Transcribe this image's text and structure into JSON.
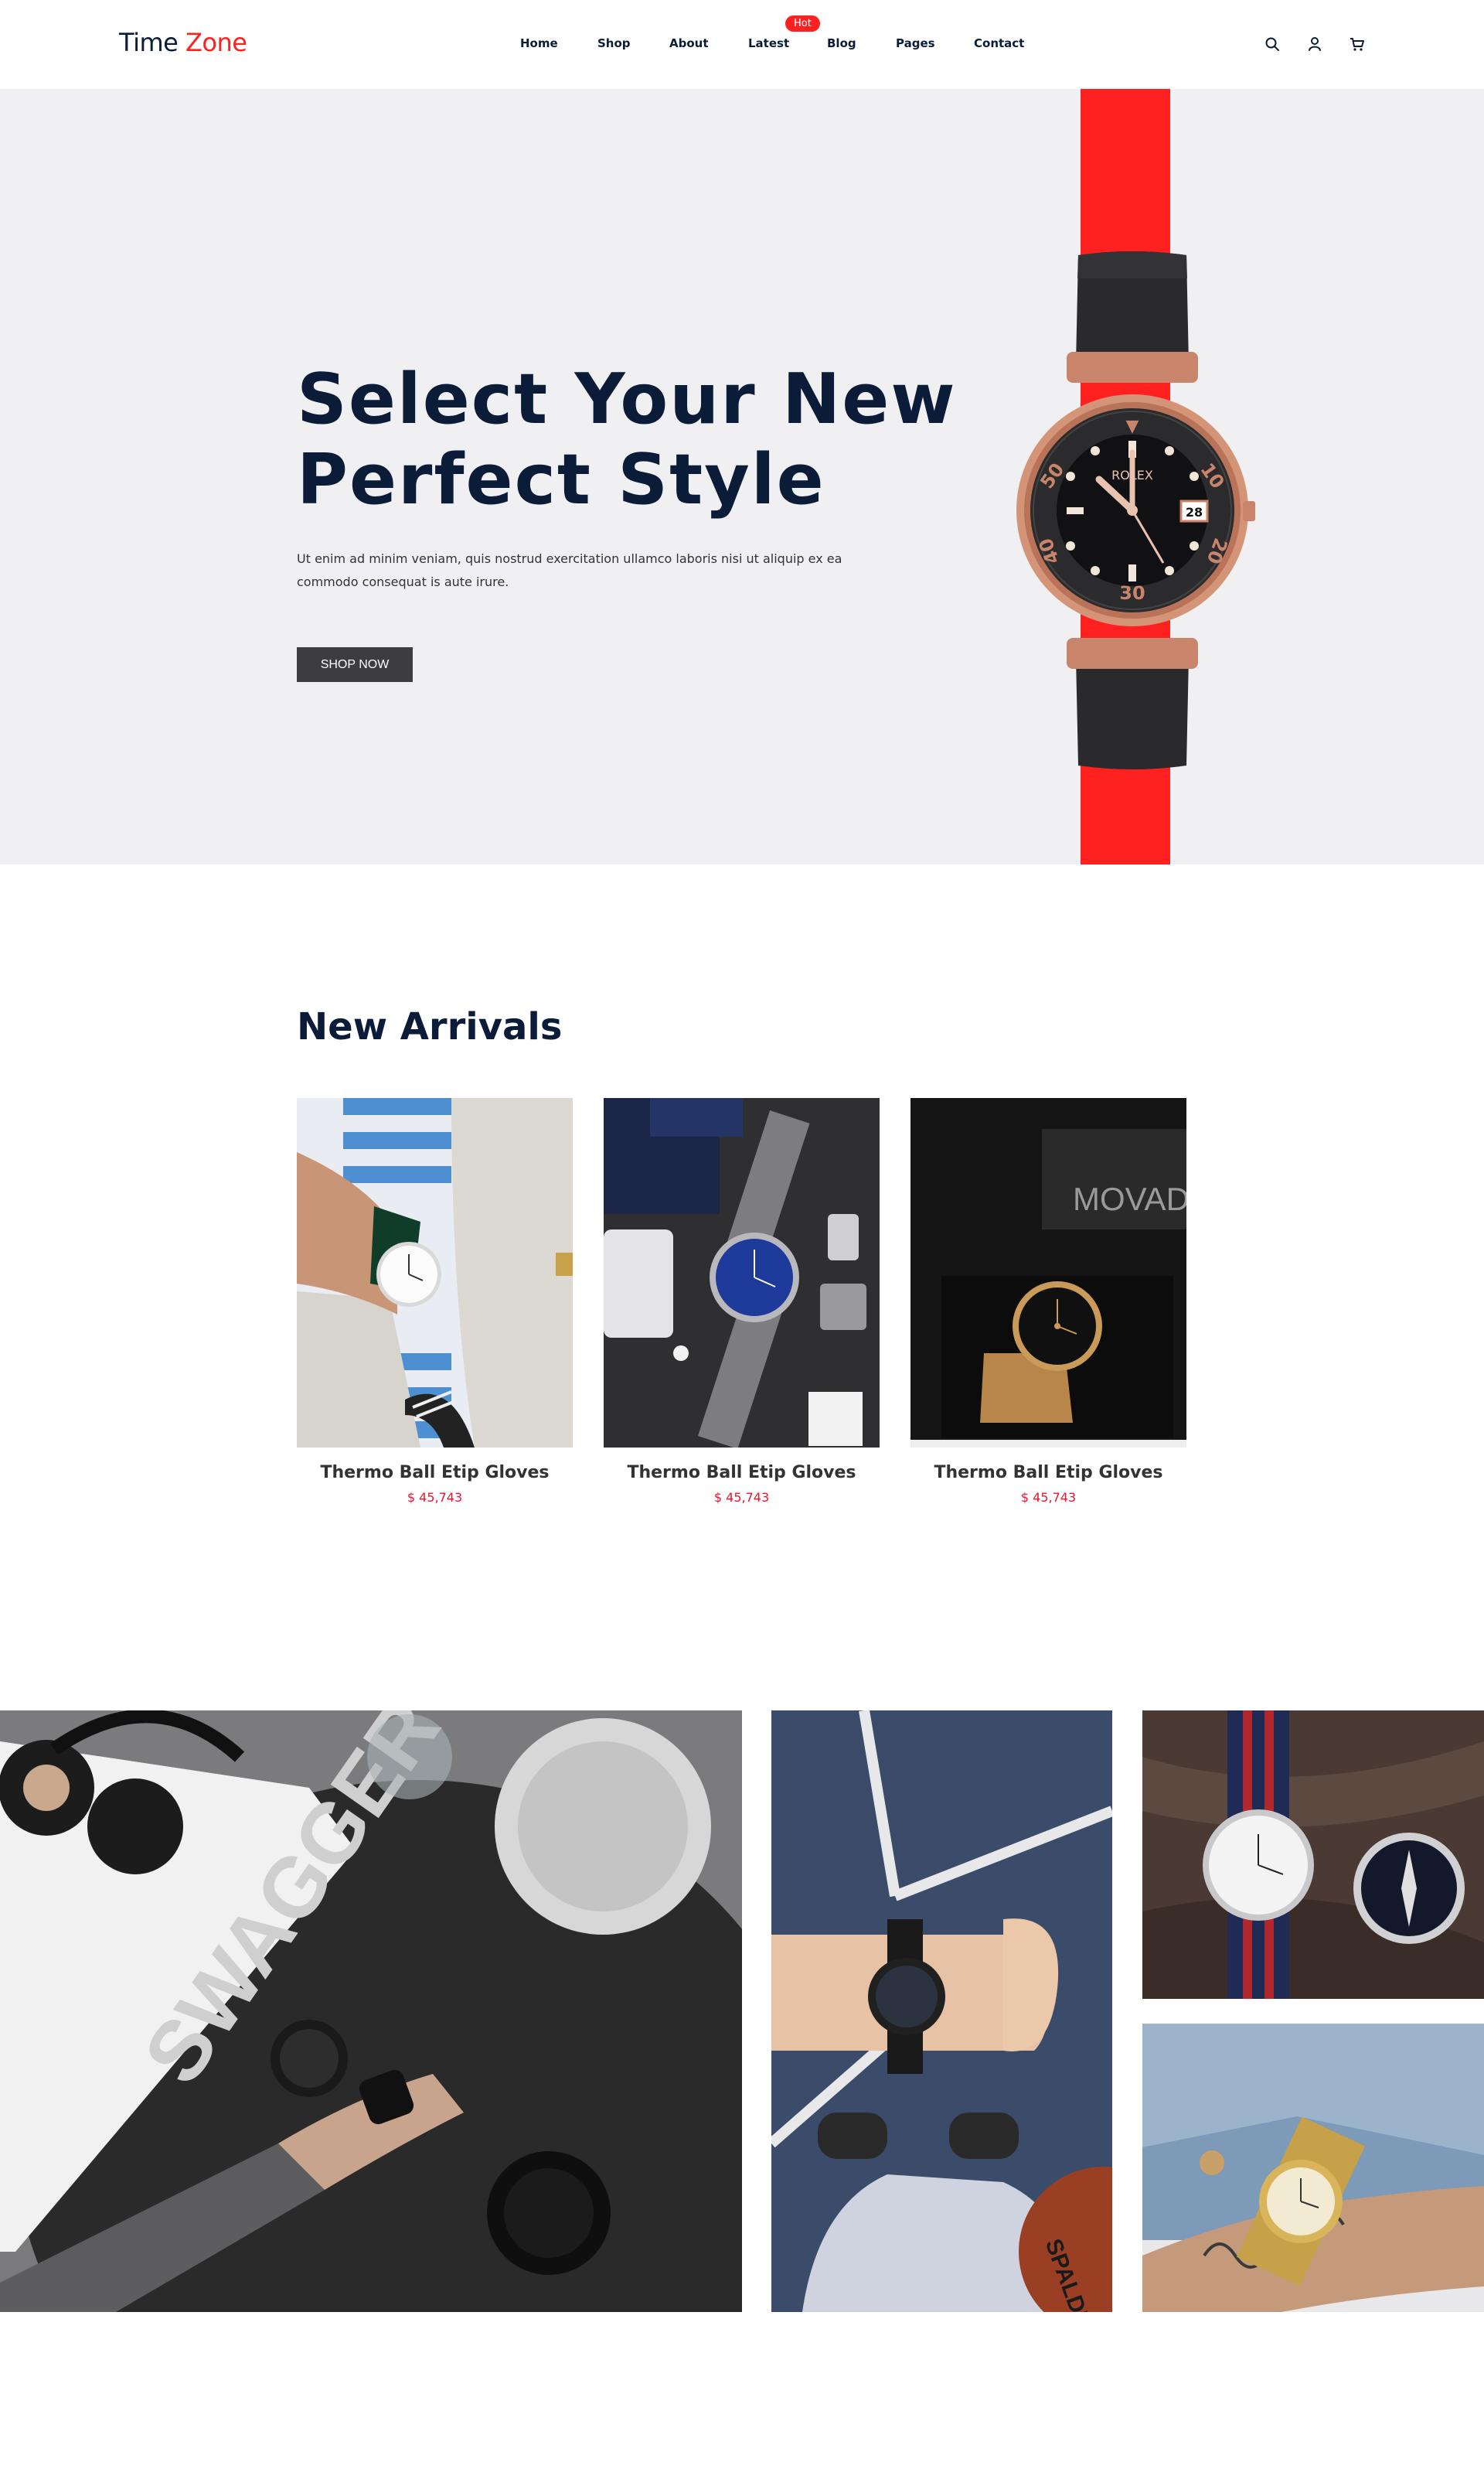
{
  "header": {
    "logo_primary": "Time",
    "logo_accent": "Zone",
    "nav": [
      "Home",
      "Shop",
      "About",
      "Latest",
      "Blog",
      "Pages",
      "Contact"
    ],
    "hot_badge": "Hot",
    "icons": [
      "search-icon",
      "user-icon",
      "cart-icon"
    ]
  },
  "hero": {
    "title": "Select Your New\nPerfect Style",
    "description": "Ut enim ad minim veniam, quis nostrud exercitation ullamco laboris nisi ut aliquip ex ea commodo consequat is aute irure.",
    "button_label": "SHOP NOW",
    "watch_brand": "ROLEX",
    "accent_color": "#ff2020"
  },
  "arrivals": {
    "title": "New Arrivals",
    "products": [
      {
        "name": "Thermo Ball Etip Gloves",
        "price": "$ 45,743"
      },
      {
        "name": "Thermo Ball Etip Gloves",
        "price": "$ 45,743"
      },
      {
        "name": "Thermo Ball Etip Gloves",
        "price": "$ 45,743",
        "box_text": "MOVADO"
      }
    ]
  },
  "gallery": {
    "magazine_text": "SWAGGER",
    "ball_text": "SPALDING"
  },
  "colors": {
    "navy": "#0b1c39",
    "red": "#ff2020",
    "price": "#e8152c",
    "hero_bg": "#f0f0f2"
  }
}
